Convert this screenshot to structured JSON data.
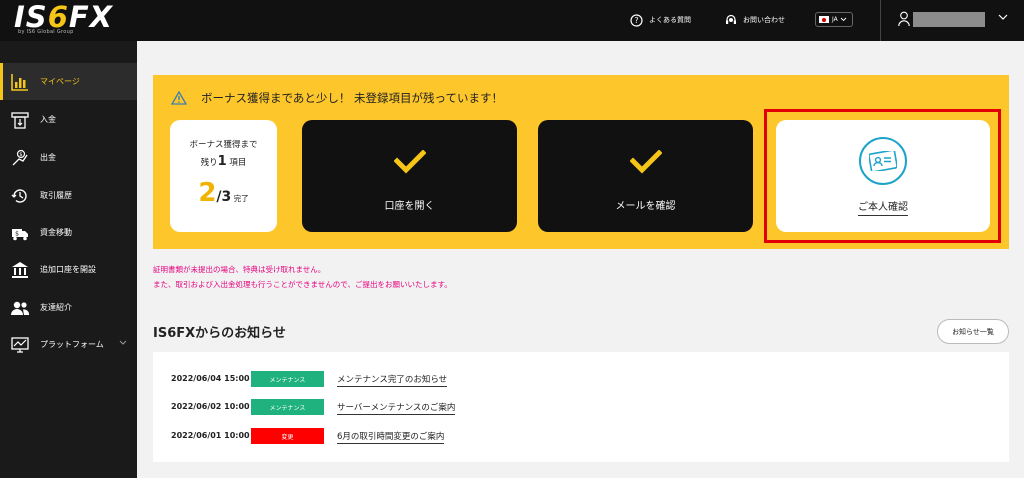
{
  "header": {
    "logo_main_pre": "IS",
    "logo_main_six": "6",
    "logo_main_post": "FX",
    "logo_sub": "by IS6 Global Group",
    "faq_label": "よくある質問",
    "contact_label": "お問い合わせ",
    "lang_label": "JA"
  },
  "sidebar": {
    "items": [
      {
        "label": "マイページ",
        "icon": "bar-chart-icon",
        "active": true
      },
      {
        "label": "入金",
        "icon": "deposit-icon"
      },
      {
        "label": "出金",
        "icon": "withdraw-icon"
      },
      {
        "label": "取引履歴",
        "icon": "history-icon"
      },
      {
        "label": "資金移動",
        "icon": "transfer-truck-icon"
      },
      {
        "label": "追加口座を開設",
        "icon": "bank-icon"
      },
      {
        "label": "友達紹介",
        "icon": "friends-icon"
      },
      {
        "label": "プラットフォーム",
        "icon": "monitor-chart-icon"
      }
    ]
  },
  "banner": {
    "title": "ボーナス獲得まであと少し！ 未登録項目が残っています！",
    "remain_line1": "ボーナス獲得まで",
    "remain_prefix": "残り",
    "remain_count": "1",
    "remain_suffix": " 項目",
    "progress_done": "2",
    "progress_total": "/3",
    "progress_label": " 完了",
    "steps": [
      {
        "label": "口座を開く",
        "status": "done"
      },
      {
        "label": "メールを確認",
        "status": "done"
      },
      {
        "label": "ご本人確認",
        "status": "pending"
      }
    ]
  },
  "notice": {
    "line1": "証明書類が未提出の場合、特典は受け取れません。",
    "line2": "また、取引および入出金処理も行うことができませんので、ご提出をお願いいたします。"
  },
  "news": {
    "title": "IS6FXからのお知らせ",
    "all_label": "お知らせ一覧",
    "items": [
      {
        "date": "2022/06/04 15:00",
        "tag": "メンテナンス",
        "tag_color": "#1fb27e",
        "title": "メンテナンス完了のお知らせ"
      },
      {
        "date": "2022/06/02 10:00",
        "tag": "メンテナンス",
        "tag_color": "#1fb27e",
        "title": "サーバーメンテナンスのご案内"
      },
      {
        "date": "2022/06/01 10:00",
        "tag": "変更",
        "tag_color": "#ff0000",
        "title": "6月の取引時間変更のご案内"
      }
    ]
  },
  "colors": {
    "accent": "#fdc62a",
    "highlight": "#e00000",
    "kyc_icon": "#1ca3c9"
  }
}
